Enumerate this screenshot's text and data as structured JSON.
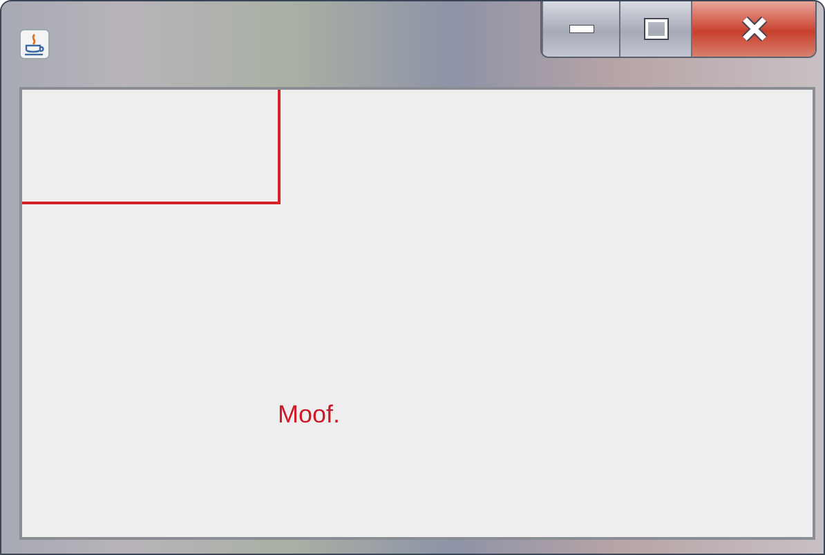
{
  "canvas": {
    "text": "Moof."
  }
}
